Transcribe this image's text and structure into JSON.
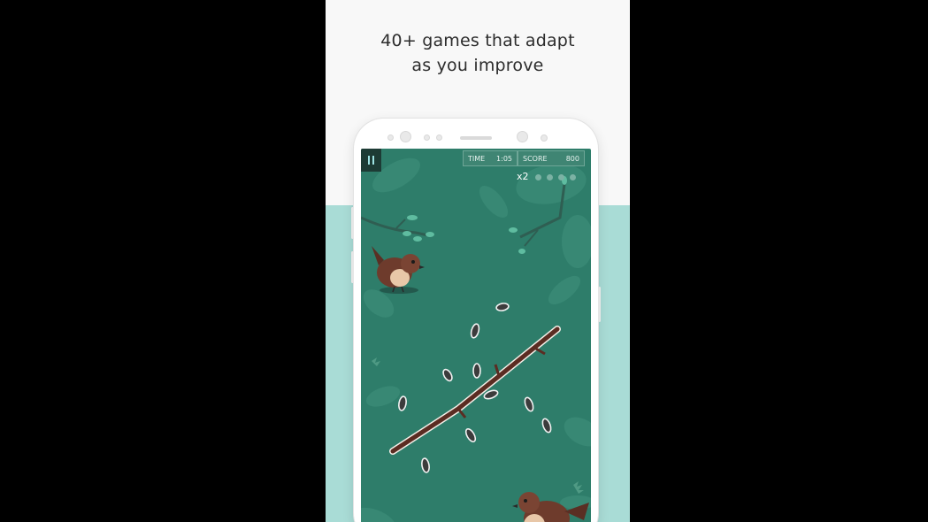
{
  "headline": {
    "line1": "40+ games that adapt",
    "line2": "as you improve"
  },
  "game": {
    "hud": {
      "time_label": "TIME",
      "time_value": "1:05",
      "score_label": "SCORE",
      "score_value": "800"
    },
    "multiplier": "x2",
    "multiplier_dots": {
      "filled": 0,
      "total": 4
    },
    "pause_icon": "pause-icon"
  },
  "colors": {
    "background": "#000000",
    "card": "#f8f8f8",
    "teal_band": "#a9dcd6",
    "game_bg": "#2e7d6a",
    "bird": "#6e3b2c",
    "branch": "#5b2c22"
  }
}
